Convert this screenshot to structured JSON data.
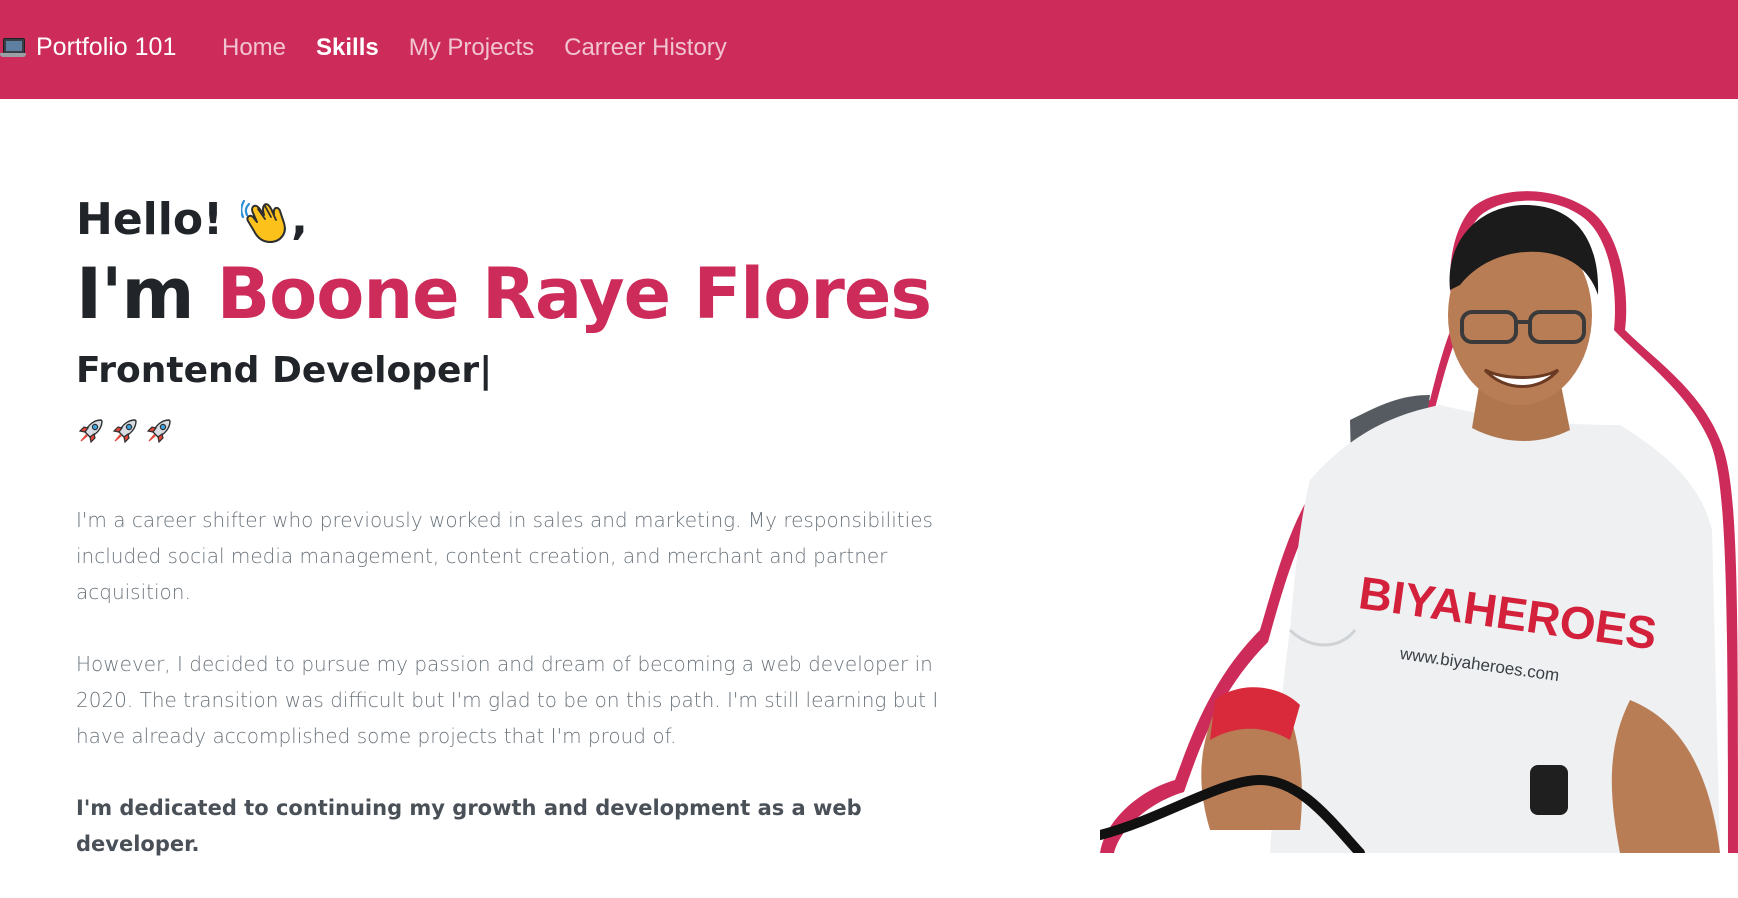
{
  "nav": {
    "brand": "Portfolio 101",
    "brand_icon": "laptop-icon",
    "links": [
      {
        "label": "Home",
        "active": false
      },
      {
        "label": "Skills",
        "active": true
      },
      {
        "label": "My Projects",
        "active": false
      },
      {
        "label": "Carreer History",
        "active": false
      }
    ]
  },
  "hero": {
    "greeting": "Hello!",
    "greeting_suffix": ",",
    "greeting_icon": "waving-hand-icon",
    "intro_prefix": "I'm",
    "name": "Boone Raye Flores",
    "role": "Frontend Developer|",
    "rocket_icons": [
      "rocket-icon",
      "rocket-icon",
      "rocket-icon"
    ]
  },
  "bio": {
    "paragraph_1": "I'm a career shifter who previously worked in sales and marketing. My responsibilities included social media management, content creation, and merchant and partner acquisition.",
    "paragraph_2": "However, I decided to pursue my passion and dream of becoming a web developer in 2020. The transition was difficult but I'm glad to be on this path. I'm still learning but I have already accomplished some projects that I'm proud of.",
    "paragraph_3": "I'm dedicated to continuing my growth and development as a web developer."
  },
  "portrait": {
    "shirt_text": "BIYAHEROES",
    "shirt_url": "www.biyaheroes.com"
  },
  "colors": {
    "accent": "#cd2c5a",
    "text_dark": "#212529",
    "text_muted": "#6c757d"
  }
}
